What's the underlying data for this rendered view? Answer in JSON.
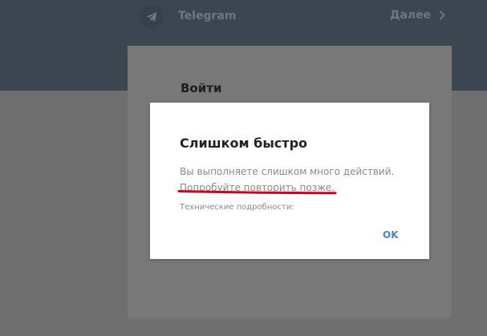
{
  "header": {
    "title": "Telegram",
    "next_label": "Далее",
    "logo_icon": "paper-plane-icon",
    "next_icon": "chevron-right-icon"
  },
  "login": {
    "title": "Войти"
  },
  "dialog": {
    "title": "Слишком быстро",
    "message_line_1": "Вы выполняете слишком много действий.",
    "message_line_2": "Попробуйте повторить позже.",
    "details_label": "Технические подробности:",
    "ok_label": "OK"
  },
  "colors": {
    "header_bg": "#3b4650",
    "overlay_bg": "#6f6f6f",
    "accent_link": "#4a87c9",
    "annotation_red": "#d0021b"
  }
}
